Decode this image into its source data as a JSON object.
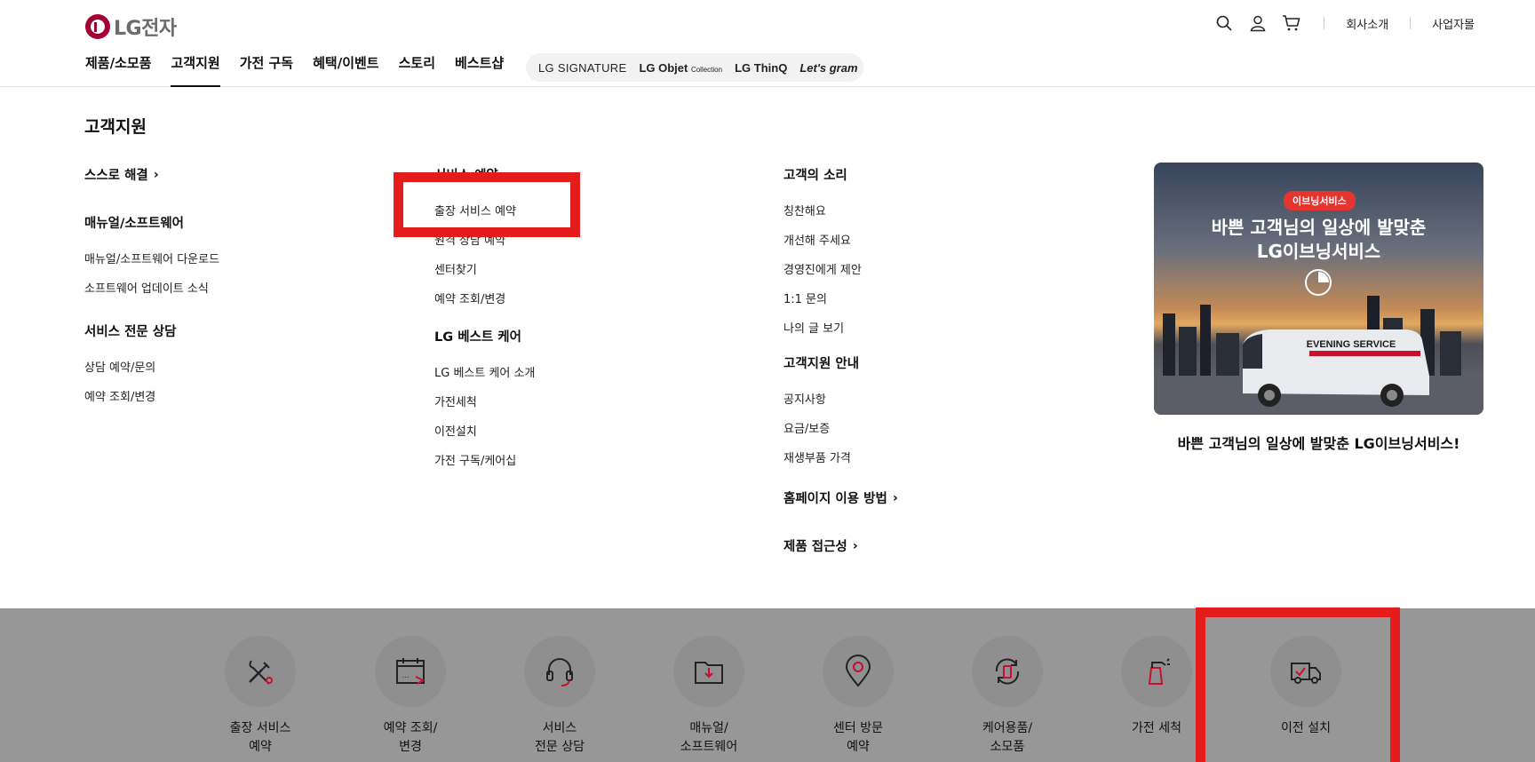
{
  "header": {
    "logo_text": "LG전자",
    "util_links": [
      "회사소개",
      "사업자몰"
    ],
    "gnb": [
      "제품/소모품",
      "고객지원",
      "가전 구독",
      "혜택/이벤트",
      "스토리",
      "베스트샵"
    ],
    "gnb_active_index": 1,
    "brands": [
      "LG SIGNATURE",
      "LG Objet",
      "Collection",
      "LG ThinQ",
      "Let's gram"
    ]
  },
  "mega": {
    "title": "고객지원",
    "col1": {
      "self": "스스로 해결",
      "manual_title": "매뉴얼/소프트웨어",
      "manual_links": [
        "매뉴얼/소프트웨어 다운로드",
        "소프트웨어 업데이트 소식"
      ],
      "consult_title": "서비스 전문 상담",
      "consult_links": [
        "상담 예약/문의",
        "예약 조회/변경"
      ]
    },
    "col2": {
      "reserve_title": "서비스 예약",
      "reserve_links": [
        "출장 서비스 예약",
        "원격 상담 예약",
        "센터찾기",
        "예약 조회/변경"
      ],
      "bestcare_title": "LG 베스트 케어",
      "bestcare_links": [
        "LG 베스트 케어 소개",
        "가전세척",
        "이전설치",
        "가전 구독/케어십"
      ]
    },
    "col3": {
      "voice_title": "고객의 소리",
      "voice_links": [
        "칭찬해요",
        "개선해 주세요",
        "경영진에게 제안",
        "1:1 문의",
        "나의 글 보기"
      ],
      "guide_title": "고객지원 안내",
      "guide_links": [
        "공지사항",
        "요금/보증",
        "재생부품 가격"
      ],
      "howto": "홈페이지 이용 방법",
      "access": "제품 접근성"
    },
    "promo": {
      "badge": "이브닝서비스",
      "headline1": "바쁜 고객님의 일상에 발맞춘",
      "headline2": "LG이브닝서비스",
      "van_text": "EVENING SERVICE",
      "caption": "바쁜 고객님의 일상에 발맞춘 LG이브닝서비스!"
    }
  },
  "quick": [
    {
      "icon": "tools-icon",
      "line1": "출장 서비스",
      "line2": "예약"
    },
    {
      "icon": "calendar-icon",
      "line1": "예약 조회/",
      "line2": "변경"
    },
    {
      "icon": "headset-icon",
      "line1": "서비스",
      "line2": "전문 상담"
    },
    {
      "icon": "folder-download-icon",
      "line1": "매뉴얼/",
      "line2": "소프트웨어"
    },
    {
      "icon": "location-pin-icon",
      "line1": "센터 방문",
      "line2": "예약"
    },
    {
      "icon": "recycle-battery-icon",
      "line1": "케어용품/",
      "line2": "소모품"
    },
    {
      "icon": "spray-cleaner-icon",
      "line1": "가전 세척",
      "line2": ""
    },
    {
      "icon": "moving-truck-icon",
      "line1": "이전 설치",
      "line2": ""
    }
  ],
  "colors": {
    "brand": "#a50034",
    "highlight": "#e41c1c",
    "overlay": "#979797"
  }
}
